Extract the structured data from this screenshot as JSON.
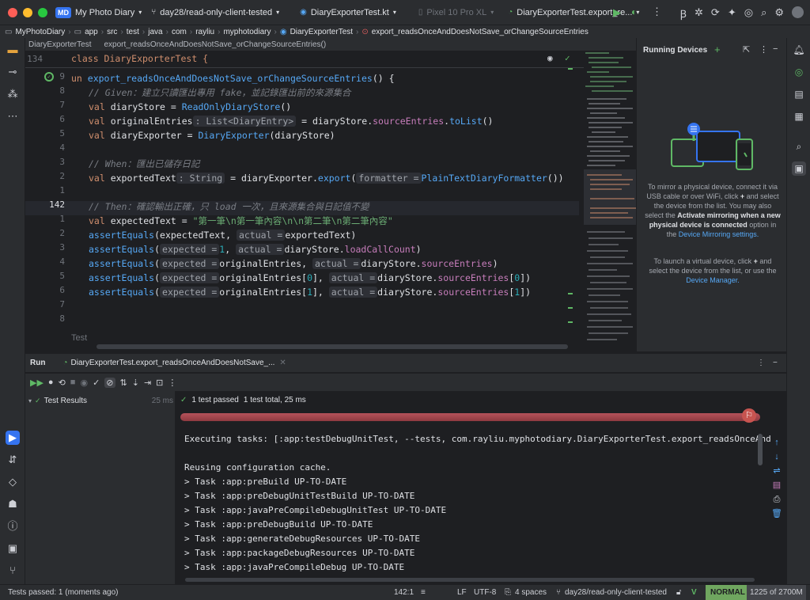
{
  "colors": {
    "accent": "#3574f0",
    "pass": "#5fb865",
    "fail": "#db5c5c",
    "mode": "#6fa65f"
  },
  "titlebar": {
    "project_badge": "MD",
    "project_name": "My Photo Diary",
    "branch": "day28/read-only-client-tested",
    "file_tab": "DiaryExporterTest.kt",
    "device": "Pixel 10 Pro XL",
    "run_config": "DiaryExporterTest.export_re..."
  },
  "breadcrumb": [
    "MyPhotoDiary",
    "app",
    "src",
    "test",
    "java",
    "com",
    "rayliu",
    "myphotodiary",
    "DiaryExporterTest",
    "export_readsOnceAndDoesNotSave_orChangeSourceEntries"
  ],
  "editor_tabs": [
    "DiaryExporterTest",
    "export_readsOnceAndDoesNotSave_orChangeSourceEntries()"
  ],
  "sticky": {
    "line": "134",
    "text": "class DiaryExporterTest {"
  },
  "gutter": [
    "9",
    "8",
    "7",
    "6",
    "5",
    "4",
    "3",
    "2",
    "1",
    "142",
    "1",
    "2",
    "3",
    "4",
    "5",
    "6",
    "7",
    "8"
  ],
  "code": {
    "l0": {
      "kw": "un ",
      "fn": "export_readsOnceAndDoesNotSave_orChangeSourceEntries",
      "rest": "() {"
    },
    "l1": "// Given：建立只讀匯出專用 fake，並記錄匯出前的來源集合",
    "l2": {
      "kw": "val ",
      "a": "diaryStore = ",
      "fn": "ReadOnlyDiaryStore",
      "b": "()"
    },
    "l3": {
      "kw": "val ",
      "a": "originalEntries",
      "hint": ": List<DiaryEntry>",
      "b": " = diaryStore.",
      "p1": "sourceEntries",
      "c": ".",
      "fn": "toList",
      "d": "()"
    },
    "l4": {
      "kw": "val ",
      "a": "diaryExporter = ",
      "fn": "DiaryExporter",
      "b": "(diaryStore)"
    },
    "l6": "// When：匯出已儲存日記",
    "l7": {
      "kw": "val ",
      "a": "exportedText",
      "hint": ": String",
      "b": " = diaryExporter.",
      "fn": "export",
      "c": "(",
      "hint2": "formatter =",
      "fn2": "PlainTextDiaryFormatter",
      "d": "())"
    },
    "l9": "// Then：確認輸出正確，只 load 一次，且來源集合與日記值不變",
    "l10": {
      "kw": "val ",
      "a": "expectedText = ",
      "s": "\"第一筆\\n第一筆內容\\n\\n第二筆\\n第二筆內容\""
    },
    "l11": {
      "fn": "assertEquals",
      "a": "(expectedText, ",
      "h": "actual =",
      "b": "exportedText)"
    },
    "l12": {
      "fn": "assertEquals",
      "a": "(",
      "h": "expected =",
      "n": "1",
      "b": ", ",
      "h2": "actual =",
      "c": "diaryStore.",
      "p": "loadCallCount",
      "d": ")"
    },
    "l13": {
      "fn": "assertEquals",
      "a": "(",
      "h": "expected =",
      "b": "originalEntries, ",
      "h2": "actual =",
      "c": "diaryStore.",
      "p": "sourceEntries",
      "d": ")"
    },
    "l14": {
      "fn": "assertEquals",
      "a": "(",
      "h": "expected =",
      "b": "originalEntries[",
      "n": "0",
      "c": "], ",
      "h2": "actual =",
      "d": "diaryStore.",
      "p": "sourceEntries",
      "e": "[",
      "n2": "0",
      "f": "])"
    },
    "l15": {
      "fn": "assertEquals",
      "a": "(",
      "h": "expected =",
      "b": "originalEntries[",
      "n": "1",
      "c": "], ",
      "h2": "actual =",
      "d": "diaryStore.",
      "p": "sourceEntries",
      "e": "[",
      "n2": "1",
      "f": "])"
    },
    "bottom": "Test"
  },
  "devices": {
    "title": "Running Devices",
    "p1a": "To mirror a physical device, connect it via USB cable or over WiFi, click",
    "p1b": "and select the device from the list. You may also select the",
    "p1c": "Activate mirroring when a new physical device is connected",
    "p1d": "option in the",
    "p1e": "Device Mirroring settings.",
    "p2a": "To launch a virtual device, click",
    "p2b": "and select the device from the list, or use the",
    "p2c": "Device Manager."
  },
  "run": {
    "tab_run": "Run",
    "tab_config": "DiaryExporterTest.export_readsOnceAndDoesNotSave_...",
    "tree_root": "Test Results",
    "tree_time": "25 ms",
    "passed": "1 test passed",
    "total": "1 test total, 25 ms",
    "console": [
      "Executing tasks: [:app:testDebugUnitTest, --tests, com.rayliu.myphotodiary.DiaryExporterTest.export_readsOnceAnd",
      "",
      "Reusing configuration cache.",
      "> Task :app:preBuild UP-TO-DATE",
      "> Task :app:preDebugUnitTestBuild UP-TO-DATE",
      "> Task :app:javaPreCompileDebugUnitTest UP-TO-DATE",
      "> Task :app:preDebugBuild UP-TO-DATE",
      "> Task :app:generateDebugResources UP-TO-DATE",
      "> Task :app:packageDebugResources UP-TO-DATE",
      "> Task :app:javaPreCompileDebug UP-TO-DATE"
    ]
  },
  "status": {
    "left": "Tests passed: 1 (moments ago)",
    "position": "142:1",
    "line_sep": "LF",
    "encoding": "UTF-8",
    "indent": "4 spaces",
    "branch": "day28/read-only-client-tested",
    "mode": "NORMAL",
    "memory": "1225 of 2700M"
  }
}
